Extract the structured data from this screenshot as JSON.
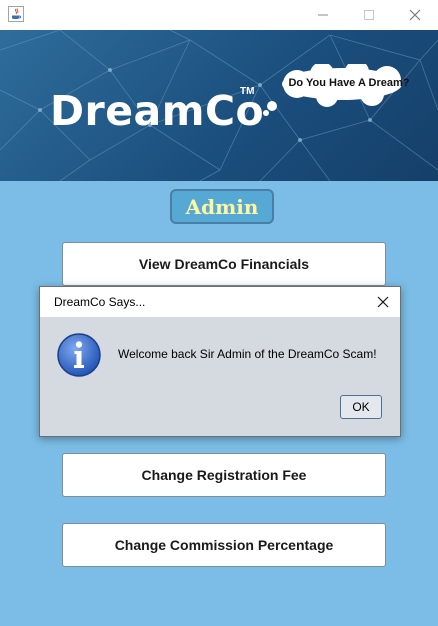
{
  "window": {
    "app_icon": "java-icon",
    "minimize_icon": "minimize-icon",
    "maximize_icon": "maximize-icon",
    "close_icon": "close-icon"
  },
  "banner": {
    "brand": "DreamCo",
    "trademark": "TM",
    "bubble_text": "Do You Have A Dream?"
  },
  "admin_badge": "Admin",
  "buttons": {
    "view_financials": "View DreamCo Financials",
    "change_registration_fee": "Change Registration Fee",
    "change_commission": "Change Commission Percentage"
  },
  "dialog": {
    "title": "DreamCo Says...",
    "message": "Welcome back Sir Admin of the DreamCo Scam!",
    "ok_label": "OK",
    "icon": "info-icon"
  },
  "colors": {
    "background": "#7bbde6",
    "banner": "#1b4f7e",
    "admin_text": "#fff6a0",
    "dialog_bg": "#d5d9e0"
  }
}
